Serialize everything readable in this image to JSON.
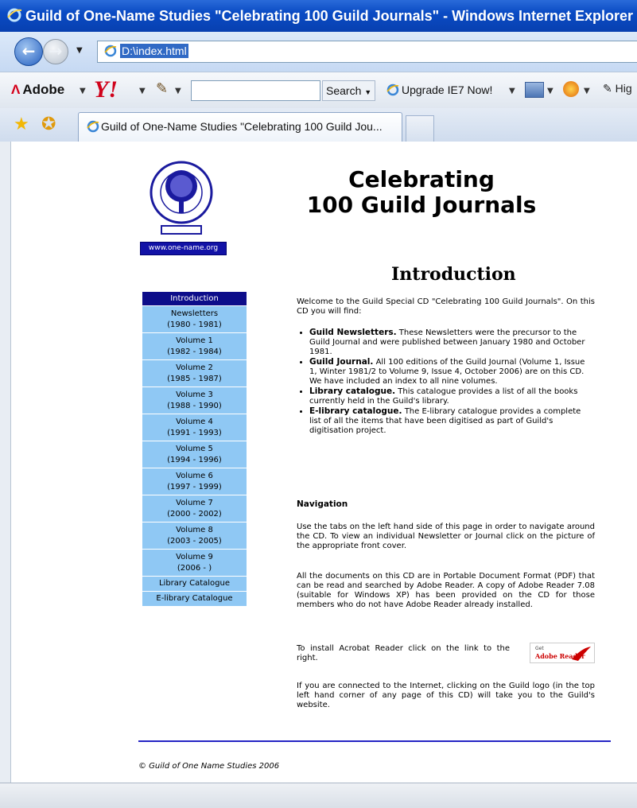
{
  "window": {
    "title": "Guild of One-Name Studies \"Celebrating 100 Guild Journals\" - Windows Internet Explorer",
    "address": "D:\\index.html"
  },
  "toolbar": {
    "adobe_label": "Adobe",
    "search_label": "Search",
    "upgrade_label": "Upgrade IE7 Now!",
    "hi_label": "Hig",
    "search_value": ""
  },
  "tab": {
    "label": "Guild of One-Name Studies \"Celebrating 100 Guild Jou..."
  },
  "page": {
    "logo_link": "www.one-name.org",
    "heading_line1": "Celebrating",
    "heading_line2": "100 Guild Journals",
    "section_title": "Introduction",
    "intro": "Welcome to the Guild Special CD \"Celebrating 100 Guild Journals\". On this CD you will find:",
    "bullets": [
      {
        "title": "Guild Newsletters.",
        "text": " These Newsletters were the precursor to the Guild Journal and were published between January 1980 and October 1981."
      },
      {
        "title": "Guild Journal.",
        "text": " All 100 editions of the Guild Journal (Volume 1, Issue 1, Winter 1981/2 to Volume 9, Issue 4, October 2006) are on this CD. We have included an index to all nine volumes."
      },
      {
        "title": "Library catalogue.",
        "text": " This catalogue provides a list of all the books currently held in the Guild's library."
      },
      {
        "title": "E-library catalogue.",
        "text": " The E-library catalogue provides a complete list of all the items that have been digitised as part of Guild's digitisation project."
      }
    ],
    "nav_heading": "Navigation",
    "nav_p1": "Use the tabs on the left hand side of this page in order to navigate around the CD. To view an individual Newsletter or Journal click on the picture of the appropriate front cover.",
    "nav_p2": "All the documents on this CD are in Portable Document Format (PDF) that can be read and searched by Adobe Reader. A copy of Adobe Reader 7.08 (suitable for Windows XP) has been provided on the CD for those members who do not have Adobe Reader already installed.",
    "install_text": "To install Acrobat Reader click on the link to the right.",
    "reader_badge_top": "Get",
    "reader_badge_bottom": "Adobe Reader",
    "internet_text": "If you are connected to the Internet, clicking on the Guild logo (in the top left hand corner of any page of this CD) will take you to the Guild's website.",
    "footer": "© Guild of One Name Studies 2006"
  },
  "menu": [
    {
      "line1": "Introduction",
      "line2": "",
      "active": true
    },
    {
      "line1": "Newsletters",
      "line2": "(1980 - 1981)"
    },
    {
      "line1": "Volume 1",
      "line2": "(1982 - 1984)"
    },
    {
      "line1": "Volume 2",
      "line2": "(1985 - 1987)"
    },
    {
      "line1": "Volume 3",
      "line2": "(1988 - 1990)"
    },
    {
      "line1": "Volume 4",
      "line2": "(1991 - 1993)"
    },
    {
      "line1": "Volume 5",
      "line2": "(1994 - 1996)"
    },
    {
      "line1": "Volume 6",
      "line2": "(1997 - 1999)"
    },
    {
      "line1": "Volume 7",
      "line2": "(2000 - 2002)"
    },
    {
      "line1": "Volume 8",
      "line2": "(2003 - 2005)"
    },
    {
      "line1": "Volume 9",
      "line2": "(2006 - )"
    },
    {
      "line1": "Library Catalogue",
      "line2": ""
    },
    {
      "line1": "E-library Catalogue",
      "line2": ""
    }
  ],
  "colors": {
    "menu_active": "#0d0d8a",
    "menu_item": "#8fc8f4",
    "title_bar": "#0a4bc4",
    "rule": "#2525c4"
  }
}
